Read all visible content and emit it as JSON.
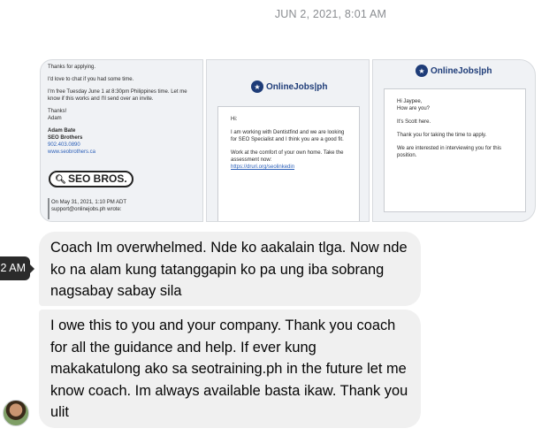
{
  "timestamp": "JUN 2, 2021, 8:01 AM",
  "tooltip": "2 AM",
  "images": {
    "img1": {
      "lines": [
        "Thanks for applying.",
        "I'd love to chat if you had some time.",
        "I'm free Tuesday June 1 at 8:30pm Philippines time. Let me know if this works and I'll send over an invite.",
        "Thanks!",
        "Adam"
      ],
      "sig_name": "Adam Bate",
      "sig_company": "SEO Brothers",
      "sig_phone": "902.403.0890",
      "sig_site": "www.seobrothers.ca",
      "logo_text": "SEO BROS.",
      "replied_line1": "On May 31, 2021, 1:10 PM ADT",
      "replied_line2": "support@onlinejobs.ph wrote:"
    },
    "img2": {
      "logo": "OnlineJobs|ph",
      "greeting": "Hi:",
      "para1": "I am working with Dentistfind and we are looking for SEO Specialist and I think you are a good fit.",
      "para2": "Work at the comfort of your own home. Take the assessment now:",
      "link": "https://druri.org/seolinkedin"
    },
    "img3": {
      "logo": "OnlineJobs|ph",
      "greeting1": "Hi Jaypee,",
      "greeting2": "How are you?",
      "para1": "It's Scott here.",
      "para2": "Thank you for taking the time to apply.",
      "para3": "We are interested in interviewing you for this position."
    }
  },
  "messages": [
    {
      "text": "Coach Im overwhelmed. Nde ko aakalain tlga. Now nde ko na alam kung tatanggapin ko pa ung iba sobrang nagsabay sabay sila"
    },
    {
      "text": "I owe this to you and your company. Thank you coach for all the guidance and help. If ever kung makakatulong ako sa seotraining.ph in the future let me know coach. Im always available basta ikaw. Thank you ulit"
    }
  ],
  "icons": {
    "logo": "onlinejobs-logo-icon",
    "search": "magnifier-icon",
    "avatar": "user-avatar"
  }
}
